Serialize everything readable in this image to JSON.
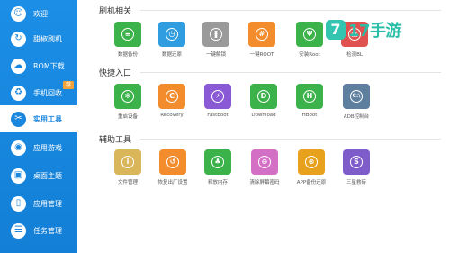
{
  "sidebar": {
    "items": [
      {
        "label": "欢迎",
        "icon": "smile-icon",
        "glyph": "☺"
      },
      {
        "label": "甜椒刷机",
        "icon": "refresh-icon",
        "glyph": "↻"
      },
      {
        "label": "ROM下载",
        "icon": "cloud-download-icon",
        "glyph": "☁"
      },
      {
        "label": "手机回收",
        "icon": "phone-recycle-icon",
        "glyph": "♻",
        "badge": "荐"
      },
      {
        "label": "实用工具",
        "icon": "tools-icon",
        "glyph": "✂",
        "active": true
      },
      {
        "label": "应用游戏",
        "icon": "gamepad-icon",
        "glyph": "◉"
      },
      {
        "label": "桌面主题",
        "icon": "theme-icon",
        "glyph": "▣"
      },
      {
        "label": "应用管理",
        "icon": "phone-icon",
        "glyph": "▯"
      },
      {
        "label": "任务管理",
        "icon": "list-icon",
        "glyph": "☰"
      }
    ]
  },
  "sections": [
    {
      "title": "刷机相关",
      "tiles": [
        {
          "label": "数据备份",
          "icon": "backup-icon",
          "glyph": "≡",
          "color": "#3bb24a"
        },
        {
          "label": "数据还原",
          "icon": "restore-icon",
          "glyph": "◷",
          "color": "#2f9de0"
        },
        {
          "label": "一键解锁",
          "icon": "unlock-icon",
          "glyph": "❚",
          "color": "#9a9a9a"
        },
        {
          "label": "一键ROOT",
          "icon": "root-icon",
          "glyph": "#",
          "color": "#f28c2d"
        },
        {
          "label": "安装Root",
          "icon": "install-root-icon",
          "glyph": "Ψ",
          "color": "#3bb24a"
        },
        {
          "label": "检测BL",
          "icon": "bl-check-icon",
          "glyph": "▣",
          "color": "#e0524f"
        }
      ]
    },
    {
      "title": "快捷入口",
      "tiles": [
        {
          "label": "重启设备",
          "icon": "reboot-icon",
          "glyph": "✻",
          "color": "#3bb24a"
        },
        {
          "label": "Recovery",
          "icon": "recovery-icon",
          "glyph": "C",
          "color": "#f28c2d"
        },
        {
          "label": "Fastboot",
          "icon": "fastboot-icon",
          "glyph": "⚡",
          "color": "#8a5ad6"
        },
        {
          "label": "Download",
          "icon": "download-icon",
          "glyph": "D",
          "color": "#3bb24a"
        },
        {
          "label": "HBoot",
          "icon": "hboot-icon",
          "glyph": "H",
          "color": "#3bb24a"
        },
        {
          "label": "ADB控制台",
          "icon": "adb-console-icon",
          "glyph": "C:\\",
          "color": "#5f7f9e"
        }
      ]
    },
    {
      "title": "辅助工具",
      "tiles": [
        {
          "label": "文件管理",
          "icon": "file-manager-icon",
          "glyph": "i",
          "color": "#d9b65a"
        },
        {
          "label": "恢复出厂设置",
          "icon": "factory-reset-icon",
          "glyph": "↺",
          "color": "#f28c2d"
        },
        {
          "label": "释放内存",
          "icon": "free-memory-icon",
          "glyph": "♣",
          "color": "#3bb24a"
        },
        {
          "label": "清除屏幕密码",
          "icon": "clear-password-icon",
          "glyph": "⊖",
          "color": "#d46fc6"
        },
        {
          "label": "APP备份还原",
          "icon": "app-backup-icon",
          "glyph": "⊗",
          "color": "#e8a11d"
        },
        {
          "label": "三星救砖",
          "icon": "samsung-rescue-icon",
          "glyph": "S",
          "color": "#7e5cc9"
        }
      ]
    }
  ],
  "watermark": {
    "digit": "7",
    "text": "17手游"
  }
}
